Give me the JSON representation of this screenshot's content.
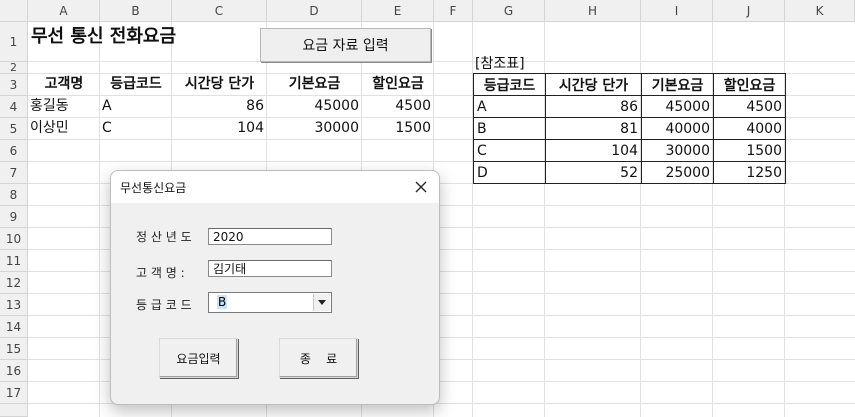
{
  "columns": [
    "A",
    "B",
    "C",
    "D",
    "E",
    "F",
    "G",
    "H",
    "I",
    "J",
    "K"
  ],
  "rows": [
    "1",
    "2",
    "3",
    "4",
    "5",
    "6",
    "7",
    "8",
    "9",
    "10",
    "11",
    "12",
    "13",
    "14",
    "15",
    "16",
    "17"
  ],
  "sheet": {
    "title": "무선 통신 전화요금",
    "button_label": "요금 자료 입력",
    "headers": [
      "고객명",
      "등급코드",
      "시간당 단가",
      "기본요금",
      "할인요금"
    ],
    "data_rows": [
      [
        "홍길동",
        "A",
        "86",
        "45000",
        "4500"
      ],
      [
        "이상민",
        "C",
        "104",
        "30000",
        "1500"
      ]
    ]
  },
  "reference": {
    "caption": "[참조표]",
    "headers": [
      "등급코드",
      "시간당 단가",
      "기본요금",
      "할인요금"
    ],
    "rows": [
      [
        "A",
        "86",
        "45000",
        "4500"
      ],
      [
        "B",
        "81",
        "40000",
        "4000"
      ],
      [
        "C",
        "104",
        "30000",
        "1500"
      ],
      [
        "D",
        "52",
        "25000",
        "1250"
      ]
    ]
  },
  "dialog": {
    "title": "무선통신요금",
    "close_icon": "close-icon",
    "year_label": "정 산 년 도",
    "year_value": "2020",
    "name_label": "고 객 명 :",
    "name_value": "김기태",
    "grade_label": "등 급 코 드",
    "grade_value": "B",
    "submit_label": "요금입력",
    "exit_label": "종    료"
  },
  "colors": {
    "accent_selection": "#cce4f7",
    "grid": "#e1e1e1",
    "header_bg": "#f0f0f0"
  }
}
